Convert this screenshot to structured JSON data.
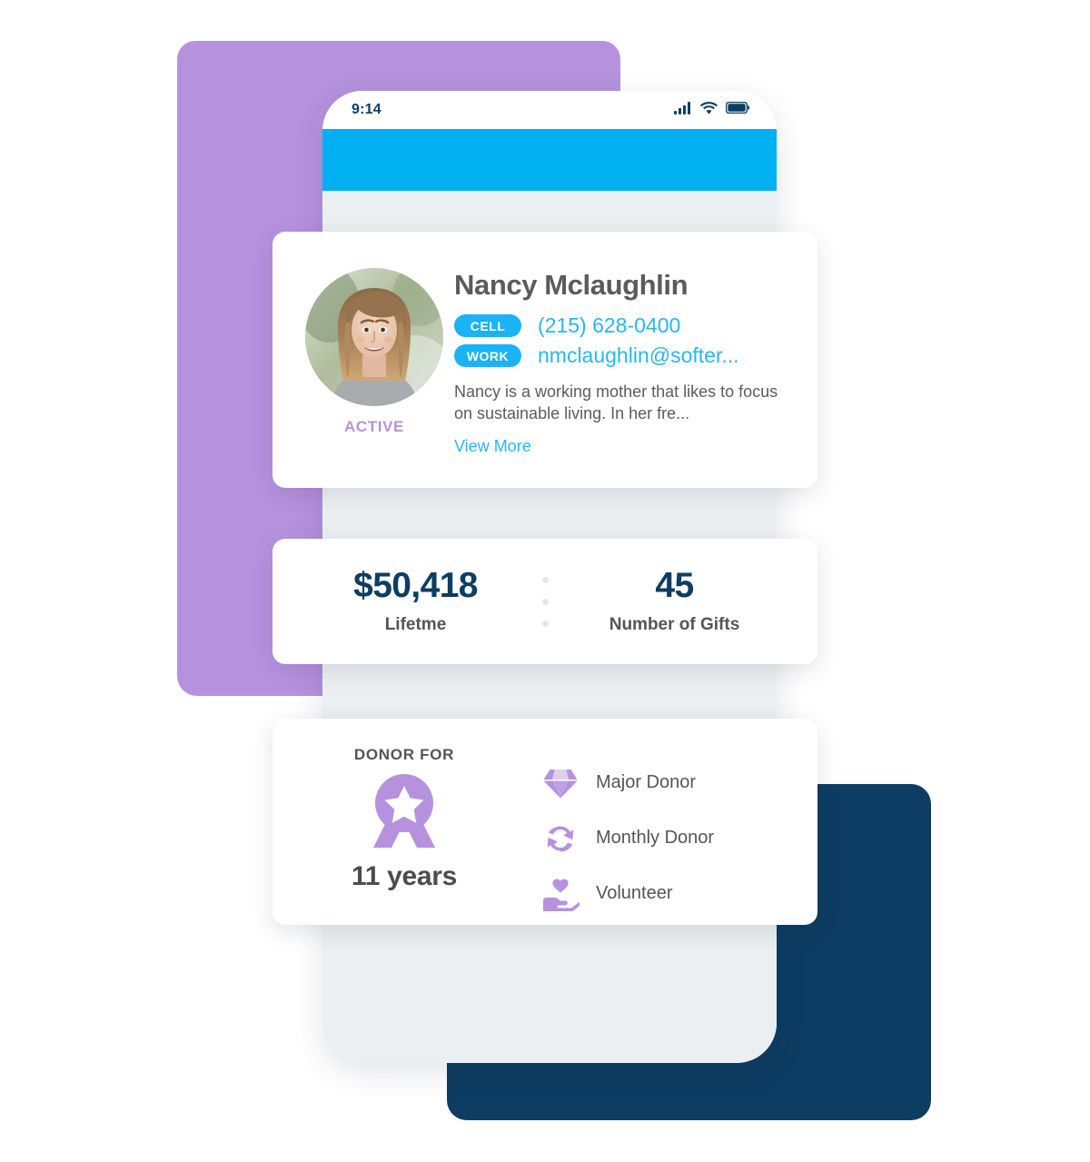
{
  "colors": {
    "purple_block": "#b692de",
    "navy_block": "#0d3d63",
    "banner_blue": "#00b0f0",
    "link_blue": "#29b6f6",
    "tag_blue": "#1ab3f5",
    "phone_body_grey": "#eceff1",
    "accent_purple": "#b692de",
    "stat_navy": "#0d3d63"
  },
  "phone": {
    "status_bar": {
      "time": "9:14",
      "icons": [
        "signal-icon",
        "wifi-icon",
        "battery-icon"
      ]
    }
  },
  "profile": {
    "avatar_alt": "portrait-photo-smiling-woman",
    "status_label": "ACTIVE",
    "name": "Nancy Mclaughlin",
    "contacts": [
      {
        "tag": "CELL",
        "value": "(215) 628-0400",
        "icon": "phone-value"
      },
      {
        "tag": "WORK",
        "value": "nmclaughlin@softer...",
        "icon": "email-value"
      }
    ],
    "bio": "Nancy is a working mother that likes to focus on sustainable living. In her fre...",
    "view_more_label": "View More"
  },
  "stats": [
    {
      "value": "$50,418",
      "label": "Lifetme"
    },
    {
      "value": "45",
      "label": "Number of Gifts"
    }
  ],
  "donor": {
    "title": "DONOR FOR",
    "badge_icon": "award-ribbon-icon",
    "years": "11 years",
    "attributes": [
      {
        "icon": "diamond-icon",
        "label": "Major Donor"
      },
      {
        "icon": "refresh-cycle-icon",
        "label": "Monthly Donor"
      },
      {
        "icon": "hand-heart-icon",
        "label": "Volunteer"
      }
    ]
  }
}
